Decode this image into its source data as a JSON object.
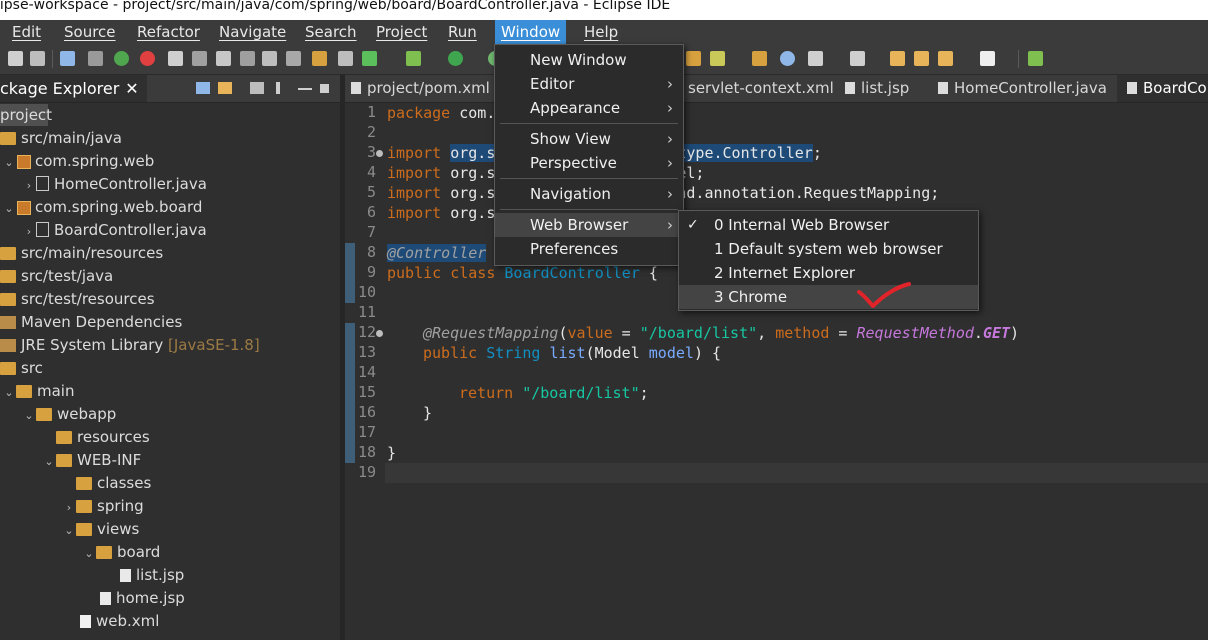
{
  "window_title": "lipse-workspace - project/src/main/java/com/spring/web/board/BoardController.java - Eclipse IDE",
  "menubar": [
    "Edit",
    "Source",
    "Refactor",
    "Navigate",
    "Search",
    "Project",
    "Run",
    "Window",
    "Help"
  ],
  "package_explorer": {
    "tab_label": "ckage Explorer",
    "tree": [
      {
        "label": "project",
        "icon": "project-icon"
      },
      {
        "label": "src/main/java",
        "icon": "source-folder-icon"
      },
      {
        "label": "com.spring.web",
        "icon": "package-icon"
      },
      {
        "label": "HomeController.java",
        "icon": "java-file-icon"
      },
      {
        "label": "com.spring.web.board",
        "icon": "package-icon"
      },
      {
        "label": "BoardController.java",
        "icon": "java-file-icon"
      },
      {
        "label": "src/main/resources",
        "icon": "source-folder-icon"
      },
      {
        "label": "src/test/java",
        "icon": "source-folder-icon"
      },
      {
        "label": "src/test/resources",
        "icon": "source-folder-icon"
      },
      {
        "label": "Maven Dependencies",
        "icon": "library-icon"
      },
      {
        "label": "JRE System Library",
        "sub": "[JavaSE-1.8]",
        "icon": "library-icon"
      },
      {
        "label": "src",
        "icon": "folder-icon"
      },
      {
        "label": "main",
        "icon": "folder-icon"
      },
      {
        "label": "webapp",
        "icon": "folder-icon"
      },
      {
        "label": "resources",
        "icon": "folder-icon"
      },
      {
        "label": "WEB-INF",
        "icon": "folder-icon"
      },
      {
        "label": "classes",
        "icon": "folder-icon"
      },
      {
        "label": "spring",
        "icon": "folder-icon"
      },
      {
        "label": "views",
        "icon": "folder-icon"
      },
      {
        "label": "board",
        "icon": "folder-icon"
      },
      {
        "label": "list.jsp",
        "icon": "jsp-file-icon"
      },
      {
        "label": "home.jsp",
        "icon": "jsp-file-icon"
      },
      {
        "label": "web.xml",
        "icon": "xml-file-icon"
      }
    ]
  },
  "editor_tabs": [
    "project/pom.xml",
    "servlet-context.xml",
    "list.jsp",
    "HomeController.java",
    "BoardCon"
  ],
  "code": {
    "line_numbers": [
      "1",
      "2",
      "3",
      "4",
      "5",
      "6",
      "7",
      "8",
      "9",
      "10",
      "11",
      "12",
      "13",
      "14",
      "15",
      "16",
      "17",
      "18",
      "19"
    ],
    "l1_kw": "package",
    "l1_rest": " com.",
    "import_kw": "import",
    "l3_a": "org.s",
    "l3_b": "type.Controller",
    "l3_c": ";",
    "l4_a": "org.s",
    "l4_b": "el;",
    "l5_a": "org.s",
    "l5_b": "nd.annotation.RequestMapping;",
    "l6_a": "org.s",
    "l8_ann": "@Controller",
    "l9_kw": "public class",
    "l9_cls": "BoardController",
    "l9_rest": " {",
    "l12_ann": "@RequestMapping",
    "l12_open": "(",
    "l12_value": "value",
    "l12_eq": " = ",
    "l12_str": "\"/board/list\"",
    "l12_comma": ", ",
    "l12_method": "method",
    "l12_eq2": " = ",
    "l12_enum": "RequestMethod",
    "l12_dot": ".",
    "l12_get": "GET",
    "l12_close": ")",
    "l13_kw": "public",
    "l13_type": "String",
    "l13_name": "list",
    "l13_open": "(",
    "l13_ptype": "Model",
    "l13_pname": "model",
    "l13_close": ") {",
    "l15_kw": "return",
    "l15_str": "\"/board/list\"",
    "l15_semi": ";",
    "l16": "}",
    "l18": "}"
  },
  "window_menu": {
    "items": [
      "New Window",
      "Editor",
      "Appearance",
      "Show View",
      "Perspective",
      "Navigation",
      "Web Browser",
      "Preferences"
    ]
  },
  "web_browser_submenu": {
    "items": [
      "0 Internal Web Browser",
      "1 Default system web browser",
      "2 Internet Explorer",
      "3 Chrome"
    ],
    "checked_index": 0
  },
  "annotation_color": "#e0242a"
}
